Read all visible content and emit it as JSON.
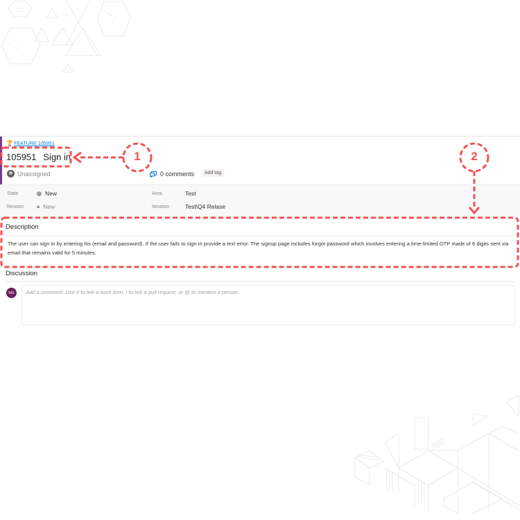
{
  "work_item": {
    "parent_link": "FEATURE 105951",
    "id": "105951",
    "title": "Sign in",
    "assignee": "Unassigned",
    "comments_count": "0 comments",
    "add_tag_label": "Add tag",
    "accent_color": "#773b93"
  },
  "fields": {
    "state": {
      "label": "State",
      "value": "New"
    },
    "reason": {
      "label": "Reason",
      "value": "New"
    },
    "area": {
      "label": "Area",
      "value": "Test"
    },
    "iteration": {
      "label": "Iteration",
      "value": "Test\\Q4 Relase"
    }
  },
  "description": {
    "title": "Description",
    "text": "The user can sign in by entering his (email and password). If the user fails to sign in provide a text error. The signup page includes forgot password which involves entering a time-limited OTP made of 6 digits sent via email that remains valid for 5 minutes."
  },
  "discussion": {
    "title": "Discussion",
    "avatar_initials": "MS",
    "comment_placeholder": "Add a comment. Use # to link a work item, ! to link a pull request, or @ to mention a person."
  },
  "annotations": {
    "callout_1": "1",
    "callout_2": "2",
    "color": "#f05252"
  },
  "icons": {
    "parent": "trophy-icon",
    "assignee": "person-icon",
    "comments": "comment-icon",
    "state": "circle-icon",
    "reason": "lock-icon"
  }
}
